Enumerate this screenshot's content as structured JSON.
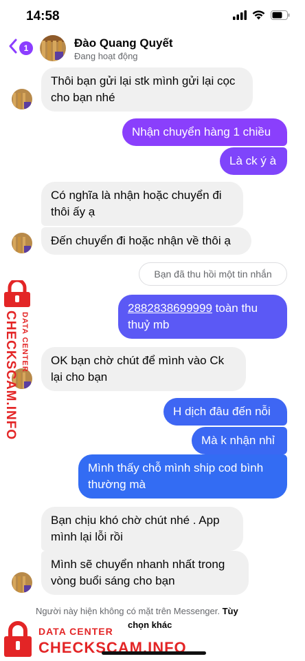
{
  "status_bar": {
    "time": "14:58"
  },
  "header": {
    "back_count": "1",
    "contact_name": "Đào Quang Quyết",
    "contact_status": "Đang hoạt động"
  },
  "messages": [
    {
      "side": "in",
      "lines": [
        "Thôi bạn gửi lại stk mình gửi lại cọc",
        "cho bạn nhé"
      ]
    },
    {
      "side": "out",
      "lines": [
        "Nhận chuyển hàng 1 chiều"
      ]
    },
    {
      "side": "out",
      "lines": [
        "Là ck ý à"
      ]
    },
    {
      "side": "in",
      "lines": [
        "Có nghĩa là nhận hoặc chuyển đi",
        "thôi ấy ạ"
      ]
    },
    {
      "side": "in",
      "lines": [
        "Đến chuyển đi hoặc nhận về thôi ạ"
      ]
    },
    {
      "side": "out",
      "link": "2882838699999",
      "lines": [
        " toàn thu",
        "thuỷ mb"
      ]
    },
    {
      "side": "in",
      "lines": [
        "OK bạn chờ chút để mình vào Ck",
        "lại cho bạn"
      ]
    },
    {
      "side": "out",
      "lines": [
        "H dịch đâu đến nỗi"
      ]
    },
    {
      "side": "out",
      "lines": [
        "Mà k nhận nhỉ"
      ]
    },
    {
      "side": "out",
      "lines": [
        "Mình thấy chỗ mình ship cod bình",
        "thường mà"
      ]
    },
    {
      "side": "in",
      "lines": [
        "Bạn chịu khó chờ chút nhé . App",
        "mình lại lỗi rồi"
      ]
    },
    {
      "side": "in",
      "lines": [
        "Mình sẽ chuyển nhanh nhất trong",
        "vòng buổi sáng cho bạn"
      ]
    }
  ],
  "unsent_notice": "Bạn đã thu hồi một tin nhắn",
  "footer": {
    "notice": "Người này hiện không có mặt trên Messenger.",
    "more_label_part1": "Tùy",
    "more_label_part2": "chọn khác"
  },
  "watermark": {
    "side_small": "DATA CENTER",
    "side_big": "CHECKSCAM.INFO",
    "bottom_small": "DATA CENTER",
    "bottom_big": "CHECKSCAM.INFO"
  },
  "colors": {
    "accent": "#8b3dff",
    "gradient_top": "#8a3ffc",
    "gradient_bottom": "#2f6df2",
    "incoming_bubble": "#f0f0f0",
    "watermark_red": "#e32526"
  }
}
